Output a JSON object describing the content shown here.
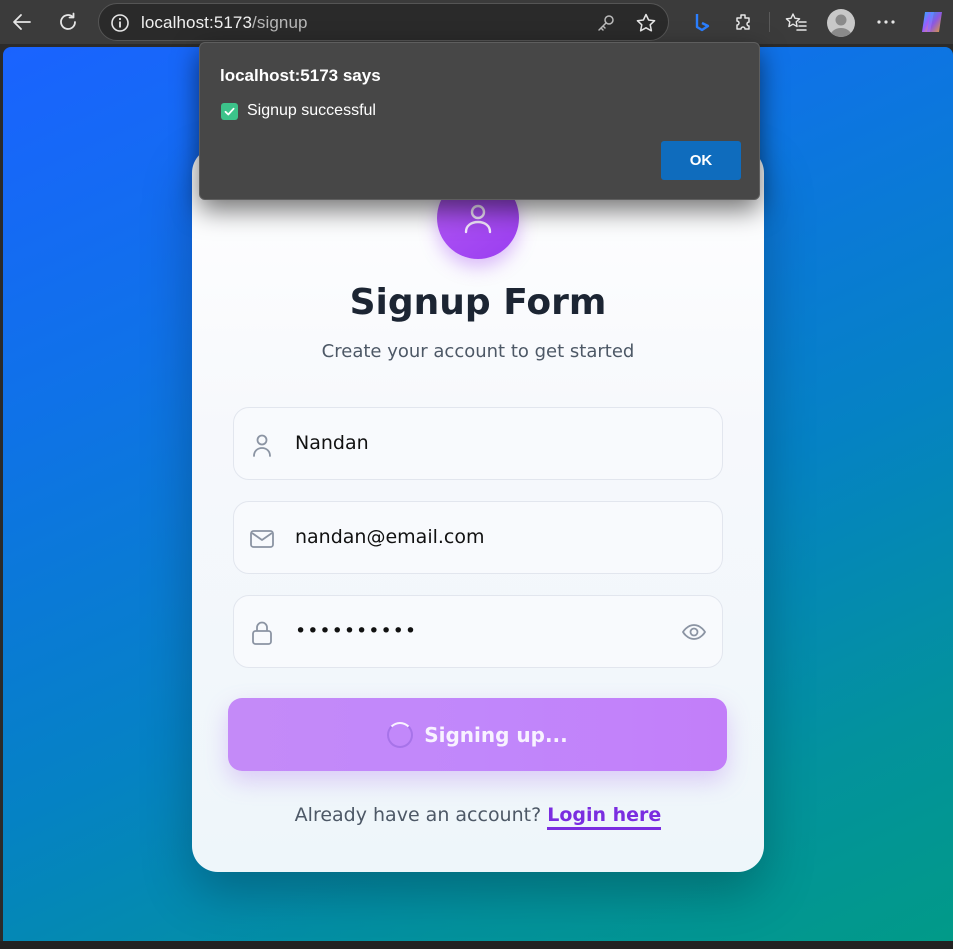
{
  "browser": {
    "url_host": "localhost:5173",
    "url_path": "/signup",
    "icons": [
      "back-icon",
      "reload-icon",
      "info-icon",
      "key-icon",
      "star-icon",
      "bing-icon",
      "extensions-icon",
      "favorites-icon",
      "profile-icon",
      "more-icon",
      "copilot-icon"
    ]
  },
  "dialog": {
    "title": "localhost:5173 says",
    "message": "Signup successful",
    "ok_label": "OK"
  },
  "form": {
    "title": "Signup Form",
    "subtitle": "Create your account to get started",
    "name_value": "Nandan",
    "email_value": "nandan@email.com",
    "password_value": "••••••••••",
    "submit_label": "Signing up...",
    "footer_text": "Already have an account?",
    "login_link": "Login here"
  },
  "colors": {
    "accent_purple": "#9a3df0",
    "link": "#7a2de0",
    "gradient_start": "#1a63ff",
    "gradient_end": "#019a88",
    "ok_button": "#0f6cbd"
  }
}
